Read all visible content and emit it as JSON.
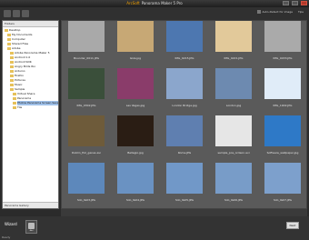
{
  "window": {
    "brand": "ArcSoft",
    "title": "Panorama Maker 5 Pro"
  },
  "toolbar": {
    "auto_detect": "Auto-Detect for image",
    "tip": "Tips"
  },
  "sidebar": {
    "header": "Folders",
    "items": [
      {
        "label": "Desktop"
      },
      {
        "label": "My Documents"
      },
      {
        "label": "Computer"
      },
      {
        "label": "Shared Files"
      },
      {
        "label": "Adobe"
      },
      {
        "label": "Adobe Panorama Maker 5"
      },
      {
        "label": "Android 1.0"
      },
      {
        "label": "Android SDK"
      },
      {
        "label": "Angry Birds Rio"
      },
      {
        "label": "Arduino"
      },
      {
        "label": "Firefox"
      },
      {
        "label": "Pictures"
      },
      {
        "label": "Music"
      },
      {
        "label": "Sample"
      },
      {
        "label": "Virtual Share"
      },
      {
        "label": "Panorama"
      },
      {
        "label": "Photos Panorama Screen Saver",
        "selected": true
      },
      {
        "label": "Tile"
      }
    ],
    "bottom": "Panorama Gallery"
  },
  "thumbnails": [
    {
      "caption": "Boundar_0011.JPG",
      "color": "#a9a9a9"
    },
    {
      "caption": "Giza.jpg",
      "color": "#c7a875"
    },
    {
      "caption": "IMG_0215.JPG",
      "color": "#4d77b0"
    },
    {
      "caption": "IMG_0221.JPG",
      "color": "#e2c99a"
    },
    {
      "caption": "IMG_0433.JPG",
      "color": "#aaaaaa"
    },
    {
      "caption": "IMG_0302.JPG",
      "color": "#3a4f3a"
    },
    {
      "caption": "Las Vegas.jpg",
      "color": "#8a3c6a"
    },
    {
      "caption": "London Bridge.jpg",
      "color": "#8ba6cc"
    },
    {
      "caption": "London.jpg",
      "color": "#6d8ab0"
    },
    {
      "caption": "IMG_1902.JPG",
      "color": "#e0ecf8"
    },
    {
      "caption": "Dublin_Hol_genes.avi",
      "color": "#6e5b3a"
    },
    {
      "caption": "Bellagio.jpg",
      "color": "#2a1d14"
    },
    {
      "caption": "Rome.JPG",
      "color": "#5f7fb0"
    },
    {
      "caption": "sample_pos_ordeon.avi",
      "color": "#e6e6e6"
    },
    {
      "caption": "Software_wallpaper.jpg",
      "color": "#2e79c7"
    },
    {
      "caption": "Silo_IG03.JPG",
      "color": "#5d88bb"
    },
    {
      "caption": "Silo_IG04.JPG",
      "color": "#6a92c2"
    },
    {
      "caption": "Silo_IG05.JPG",
      "color": "#7198c8"
    },
    {
      "caption": "Silo_IG06.JPG",
      "color": "#789cc8"
    },
    {
      "caption": "Silo_IG07.JPG",
      "color": "#7da0cc"
    }
  ],
  "footer": {
    "wizard": "Wizard",
    "step_label": "Add",
    "next": "Next",
    "status": "Ready"
  }
}
